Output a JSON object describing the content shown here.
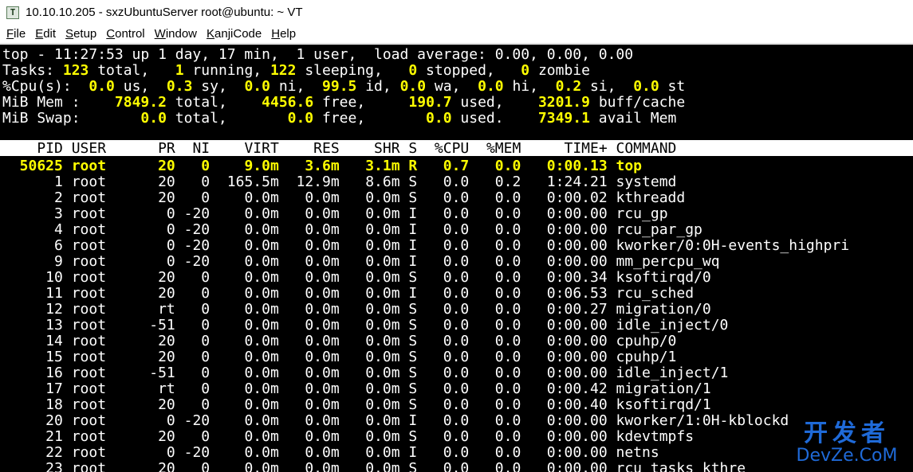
{
  "window": {
    "title": "10.10.10.205 - sxzUbuntuServer root@ubuntu: ~ VT",
    "icon": "terminal-app-icon",
    "icon_glyph": "T"
  },
  "menu": [
    {
      "label": "File",
      "hotkey": "F",
      "rest": "ile"
    },
    {
      "label": "Edit",
      "hotkey": "E",
      "rest": "dit"
    },
    {
      "label": "Setup",
      "hotkey": "S",
      "rest": "etup"
    },
    {
      "label": "Control",
      "hotkey": "C",
      "rest": "ontrol"
    },
    {
      "label": "Window",
      "hotkey": "W",
      "rest": "indow"
    },
    {
      "label": "KanjiCode",
      "hotkey": "K",
      "rest": "anjiCode"
    },
    {
      "label": "Help",
      "hotkey": "H",
      "rest": "elp"
    }
  ],
  "summary": {
    "uptime_line": "top - 11:27:53 up 1 day, 17 min,  1 user,  load average: 0.00, 0.00, 0.00",
    "tasks": {
      "label": "Tasks:",
      "total": "123",
      "running": "1",
      "sleeping": "122",
      "stopped": "0",
      "zombie": "0"
    },
    "cpu": {
      "label": "%Cpu(s):",
      "us": "0.0",
      "sy": "0.3",
      "ni": "0.0",
      "id": "99.5",
      "wa": "0.0",
      "hi": "0.0",
      "si": "0.2",
      "st": "0.0"
    },
    "mem": {
      "label": "MiB Mem :",
      "total": "7849.2",
      "free": "4456.6",
      "used": "190.7",
      "buff_cache": "3201.9"
    },
    "swap": {
      "label": "MiB Swap:",
      "total": "0.0",
      "free": "0.0",
      "used": "0.0",
      "avail": "7349.1"
    }
  },
  "columns": [
    "PID",
    "USER",
    "PR",
    "NI",
    "VIRT",
    "RES",
    "SHR",
    "S",
    "%CPU",
    "%MEM",
    "TIME+",
    "COMMAND"
  ],
  "processes": [
    {
      "pid": "50625",
      "user": "root",
      "pr": "20",
      "ni": "0",
      "virt": "9.0m",
      "res": "3.6m",
      "shr": "3.1m",
      "s": "R",
      "cpu": "0.7",
      "mem": "0.0",
      "time": "0:00.13",
      "cmd": "top"
    },
    {
      "pid": "1",
      "user": "root",
      "pr": "20",
      "ni": "0",
      "virt": "165.5m",
      "res": "12.9m",
      "shr": "8.6m",
      "s": "S",
      "cpu": "0.0",
      "mem": "0.2",
      "time": "1:24.21",
      "cmd": "systemd"
    },
    {
      "pid": "2",
      "user": "root",
      "pr": "20",
      "ni": "0",
      "virt": "0.0m",
      "res": "0.0m",
      "shr": "0.0m",
      "s": "S",
      "cpu": "0.0",
      "mem": "0.0",
      "time": "0:00.02",
      "cmd": "kthreadd"
    },
    {
      "pid": "3",
      "user": "root",
      "pr": "0",
      "ni": "-20",
      "virt": "0.0m",
      "res": "0.0m",
      "shr": "0.0m",
      "s": "I",
      "cpu": "0.0",
      "mem": "0.0",
      "time": "0:00.00",
      "cmd": "rcu_gp"
    },
    {
      "pid": "4",
      "user": "root",
      "pr": "0",
      "ni": "-20",
      "virt": "0.0m",
      "res": "0.0m",
      "shr": "0.0m",
      "s": "I",
      "cpu": "0.0",
      "mem": "0.0",
      "time": "0:00.00",
      "cmd": "rcu_par_gp"
    },
    {
      "pid": "6",
      "user": "root",
      "pr": "0",
      "ni": "-20",
      "virt": "0.0m",
      "res": "0.0m",
      "shr": "0.0m",
      "s": "I",
      "cpu": "0.0",
      "mem": "0.0",
      "time": "0:00.00",
      "cmd": "kworker/0:0H-events_highpri"
    },
    {
      "pid": "9",
      "user": "root",
      "pr": "0",
      "ni": "-20",
      "virt": "0.0m",
      "res": "0.0m",
      "shr": "0.0m",
      "s": "I",
      "cpu": "0.0",
      "mem": "0.0",
      "time": "0:00.00",
      "cmd": "mm_percpu_wq"
    },
    {
      "pid": "10",
      "user": "root",
      "pr": "20",
      "ni": "0",
      "virt": "0.0m",
      "res": "0.0m",
      "shr": "0.0m",
      "s": "S",
      "cpu": "0.0",
      "mem": "0.0",
      "time": "0:00.34",
      "cmd": "ksoftirqd/0"
    },
    {
      "pid": "11",
      "user": "root",
      "pr": "20",
      "ni": "0",
      "virt": "0.0m",
      "res": "0.0m",
      "shr": "0.0m",
      "s": "I",
      "cpu": "0.0",
      "mem": "0.0",
      "time": "0:06.53",
      "cmd": "rcu_sched"
    },
    {
      "pid": "12",
      "user": "root",
      "pr": "rt",
      "ni": "0",
      "virt": "0.0m",
      "res": "0.0m",
      "shr": "0.0m",
      "s": "S",
      "cpu": "0.0",
      "mem": "0.0",
      "time": "0:00.27",
      "cmd": "migration/0"
    },
    {
      "pid": "13",
      "user": "root",
      "pr": "-51",
      "ni": "0",
      "virt": "0.0m",
      "res": "0.0m",
      "shr": "0.0m",
      "s": "S",
      "cpu": "0.0",
      "mem": "0.0",
      "time": "0:00.00",
      "cmd": "idle_inject/0"
    },
    {
      "pid": "14",
      "user": "root",
      "pr": "20",
      "ni": "0",
      "virt": "0.0m",
      "res": "0.0m",
      "shr": "0.0m",
      "s": "S",
      "cpu": "0.0",
      "mem": "0.0",
      "time": "0:00.00",
      "cmd": "cpuhp/0"
    },
    {
      "pid": "15",
      "user": "root",
      "pr": "20",
      "ni": "0",
      "virt": "0.0m",
      "res": "0.0m",
      "shr": "0.0m",
      "s": "S",
      "cpu": "0.0",
      "mem": "0.0",
      "time": "0:00.00",
      "cmd": "cpuhp/1"
    },
    {
      "pid": "16",
      "user": "root",
      "pr": "-51",
      "ni": "0",
      "virt": "0.0m",
      "res": "0.0m",
      "shr": "0.0m",
      "s": "S",
      "cpu": "0.0",
      "mem": "0.0",
      "time": "0:00.00",
      "cmd": "idle_inject/1"
    },
    {
      "pid": "17",
      "user": "root",
      "pr": "rt",
      "ni": "0",
      "virt": "0.0m",
      "res": "0.0m",
      "shr": "0.0m",
      "s": "S",
      "cpu": "0.0",
      "mem": "0.0",
      "time": "0:00.42",
      "cmd": "migration/1"
    },
    {
      "pid": "18",
      "user": "root",
      "pr": "20",
      "ni": "0",
      "virt": "0.0m",
      "res": "0.0m",
      "shr": "0.0m",
      "s": "S",
      "cpu": "0.0",
      "mem": "0.0",
      "time": "0:00.40",
      "cmd": "ksoftirqd/1"
    },
    {
      "pid": "20",
      "user": "root",
      "pr": "0",
      "ni": "-20",
      "virt": "0.0m",
      "res": "0.0m",
      "shr": "0.0m",
      "s": "I",
      "cpu": "0.0",
      "mem": "0.0",
      "time": "0:00.00",
      "cmd": "kworker/1:0H-kblockd"
    },
    {
      "pid": "21",
      "user": "root",
      "pr": "20",
      "ni": "0",
      "virt": "0.0m",
      "res": "0.0m",
      "shr": "0.0m",
      "s": "S",
      "cpu": "0.0",
      "mem": "0.0",
      "time": "0:00.00",
      "cmd": "kdevtmpfs"
    },
    {
      "pid": "22",
      "user": "root",
      "pr": "0",
      "ni": "-20",
      "virt": "0.0m",
      "res": "0.0m",
      "shr": "0.0m",
      "s": "I",
      "cpu": "0.0",
      "mem": "0.0",
      "time": "0:00.00",
      "cmd": "netns"
    },
    {
      "pid": "23",
      "user": "root",
      "pr": "20",
      "ni": "0",
      "virt": "0.0m",
      "res": "0.0m",
      "shr": "0.0m",
      "s": "S",
      "cpu": "0.0",
      "mem": "0.0",
      "time": "0:00.00",
      "cmd": "rcu_tasks_kthre"
    }
  ],
  "watermark": {
    "cn": "开发者",
    "en": "DevZe.CoM"
  },
  "colors": {
    "terminal_bg": "#000000",
    "text": "#ffffff",
    "highlight": "#ffff00",
    "header_bg": "#ffffff",
    "watermark": "#1f6ad8"
  }
}
